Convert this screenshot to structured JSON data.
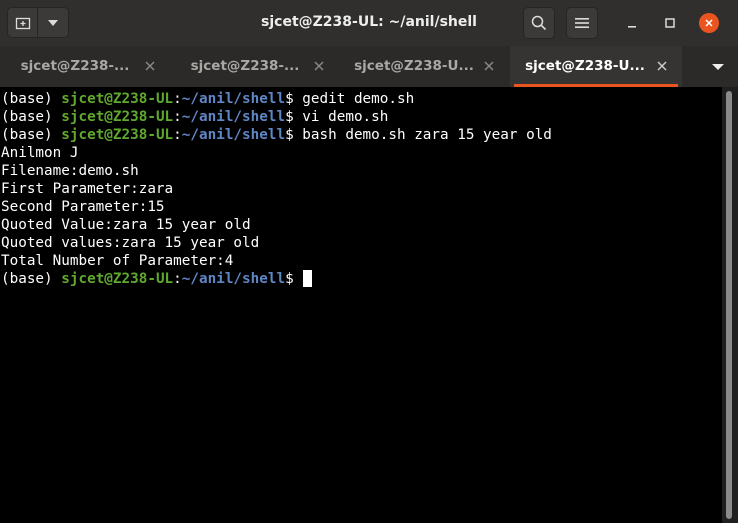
{
  "window": {
    "title": "sjcet@Z238-UL: ~/anil/shell"
  },
  "tabs": [
    {
      "label": "sjcet@Z238-..."
    },
    {
      "label": "sjcet@Z238-..."
    },
    {
      "label": "sjcet@Z238-U..."
    },
    {
      "label": "sjcet@Z238-U..."
    }
  ],
  "active_tab": 3,
  "colors": {
    "accent": "#e95420",
    "prompt_user": "#5faa2e",
    "prompt_path": "#5f86c4"
  },
  "icons": [
    "new-tab-icon",
    "dropdown-icon",
    "search-icon",
    "hamburger-menu-icon",
    "minimize-icon",
    "maximize-icon",
    "close-icon",
    "tab-close-icon",
    "tabs-menu-icon"
  ],
  "terminal": {
    "prompt_env": "(base) ",
    "prompt_user": "sjcet@Z238-UL",
    "prompt_sep": ":",
    "prompt_path": "~/anil/shell",
    "prompt_symbol": "$ ",
    "commands": [
      "gedit demo.sh",
      "vi demo.sh",
      "bash demo.sh zara 15 year old"
    ],
    "output": [
      "Anilmon J",
      "Filename:demo.sh",
      "First Parameter:zara",
      "Second Parameter:15",
      "Quoted Value:zara 15 year old",
      "Quoted values:zara 15 year old",
      "Total Number of Parameter:4"
    ]
  }
}
